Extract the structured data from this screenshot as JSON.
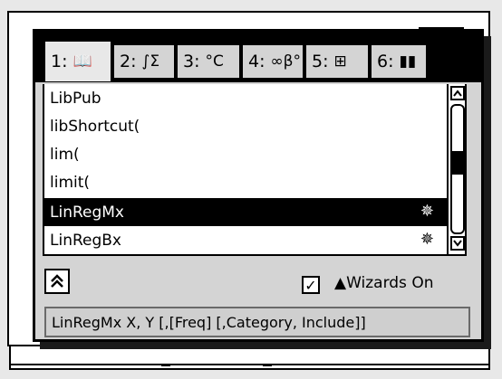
{
  "tabs": [
    {
      "number": "1:",
      "icon": "book-icon",
      "glyph": "📖"
    },
    {
      "number": "2:",
      "icon": "integral-sum-icon",
      "glyph": "∫Σ"
    },
    {
      "number": "3:",
      "icon": "unit-conversion-icon",
      "glyph": "°C"
    },
    {
      "number": "4:",
      "icon": "symbols-icon",
      "glyph": "∞β°"
    },
    {
      "number": "5:",
      "icon": "templates-icon",
      "glyph": "⊞"
    },
    {
      "number": "6:",
      "icon": "library-icon",
      "glyph": "▮▮"
    }
  ],
  "catalog": {
    "items": [
      {
        "label": "LibPub",
        "selected": false,
        "wizard": false
      },
      {
        "label": "libShortcut(",
        "selected": false,
        "wizard": false
      },
      {
        "label": "lim(",
        "selected": false,
        "wizard": false
      },
      {
        "label": "limit(",
        "selected": false,
        "wizard": false
      },
      {
        "label": "LinRegMx",
        "selected": true,
        "wizard": true
      },
      {
        "label": "LinRegBx",
        "selected": false,
        "wizard": true
      }
    ],
    "wizard_glyph": "✵"
  },
  "controls": {
    "expand_glyph": "⌃⌃",
    "wizards_checked_glyph": "✓",
    "wizards_label": "▲Wizards On"
  },
  "syntax": {
    "text": "LinRegMx X, Y [,[Freq] [,Category, Include]]"
  }
}
